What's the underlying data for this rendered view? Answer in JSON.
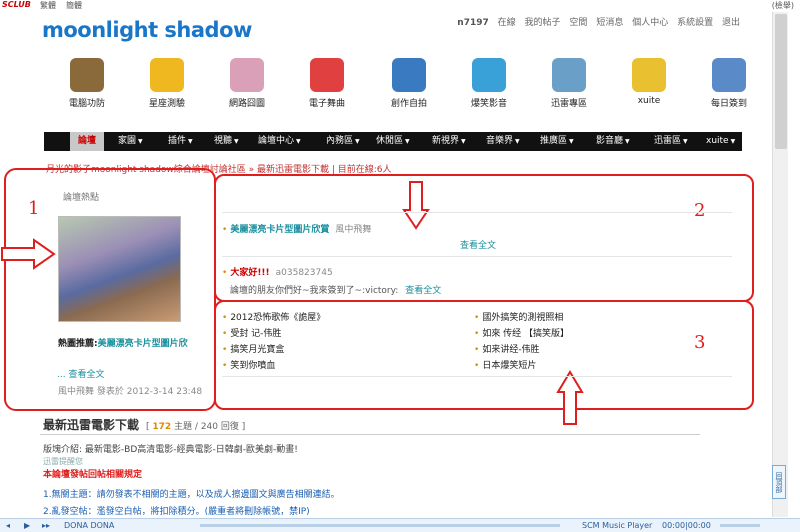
{
  "topbar": {
    "brand": "SCLUB",
    "link1": "繁體",
    "link2": "簡體",
    "right": "(檢舉)"
  },
  "header": {
    "logo": "moonlight shadow",
    "user": "n7197",
    "nav": [
      "在線",
      "我的帖子",
      "空間",
      "短消息",
      "個人中心",
      "系統設置",
      "退出"
    ]
  },
  "icons": [
    {
      "label": "電腦功防",
      "icon": "mushroom-icon",
      "color": "#8a6a3a"
    },
    {
      "label": "星座測驗",
      "icon": "balloons-icon",
      "color": "#f0b820"
    },
    {
      "label": "網路囧圖",
      "icon": "photo-icon",
      "color": "#d9a0b8"
    },
    {
      "label": "電子舞曲",
      "icon": "party-icon",
      "color": "#e04040"
    },
    {
      "label": "創作自拍",
      "icon": "house-icon",
      "color": "#3a7ac0"
    },
    {
      "label": "爆笑影音",
      "icon": "plant-icon",
      "color": "#3aa0d8"
    },
    {
      "label": "迅雷專區",
      "icon": "magnifier-icon",
      "color": "#6aa0c8"
    },
    {
      "label": "xuite",
      "icon": "box-icon",
      "color": "#e8c030"
    },
    {
      "label": "每日簽到",
      "icon": "notepad-icon",
      "color": "#5a8ac8"
    }
  ],
  "menu": [
    {
      "label": "論壇"
    },
    {
      "label": "家園"
    },
    {
      "label": "插件"
    },
    {
      "label": "視聽"
    },
    {
      "label": "論壇中心"
    },
    {
      "label": "內務區"
    },
    {
      "label": "休閒區"
    },
    {
      "label": "新視界"
    },
    {
      "label": "音樂界"
    },
    {
      "label": "推廣區"
    },
    {
      "label": "影音廳"
    },
    {
      "label": "迅雷區"
    },
    {
      "label": "xuite"
    }
  ],
  "breadcrumb": "月光的影子moonlight shadow綜合論壇討論社區 » 最新迅雷電影下載 | 目前在線:6人",
  "annotations": {
    "n1": "1",
    "n2": "2",
    "n3": "3"
  },
  "hot": {
    "title": "論壇熱點",
    "featured_label": "熱圖推薦:",
    "featured_link": "美麗漂亮卡片型圖片欣",
    "more": "... 查看全文",
    "author": "風中飛舞",
    "posted_label": "發表於",
    "date": "2012-3-14 23:48"
  },
  "posts": [
    {
      "title": "美麗漂亮卡片型圖片欣賞",
      "author": "風中飛舞",
      "readall": "查看全文"
    },
    {
      "title": "大家好!!!",
      "author": "a035823745",
      "body": "論壇的朋友你們好~我來簽到了~:victory:",
      "readall": "查看全文"
    }
  ],
  "list_left": [
    "2012恐怖歌佈《詭屋》",
    "受封 记-伟胜",
    "搞笑月光寶盒",
    "笑到你噴血"
  ],
  "list_right": [
    "國外搞笑的測視照相",
    "如來 传经 【搞笑版】",
    "如来讲经-伟胜",
    "日本爆笑短片"
  ],
  "forum": {
    "title": "最新迅雷電影下載",
    "topics": "172",
    "topics_label": "主題",
    "replies_label": "240 回復",
    "desc": "版塊介紹: 最新電影-BD高清電影-經典電影-日韓劇-歐美劇-動畫!",
    "link": "迅雷提醒您",
    "rules_title": "本論壇發帖回帖相關規定",
    "rule1": "1.無關主題：請勿發表不相關的主題，以及成人擦邊圖文與廣告相關連結。",
    "rule2": "2.亂發空帖：濫發空白帖，將扣除積分。(嚴重者將刪除帳號，禁IP)"
  },
  "player": {
    "song": "DONA DONA",
    "name": "SCM Music Player",
    "time": "00:00|00:00",
    "side_tab": "回頂部"
  }
}
